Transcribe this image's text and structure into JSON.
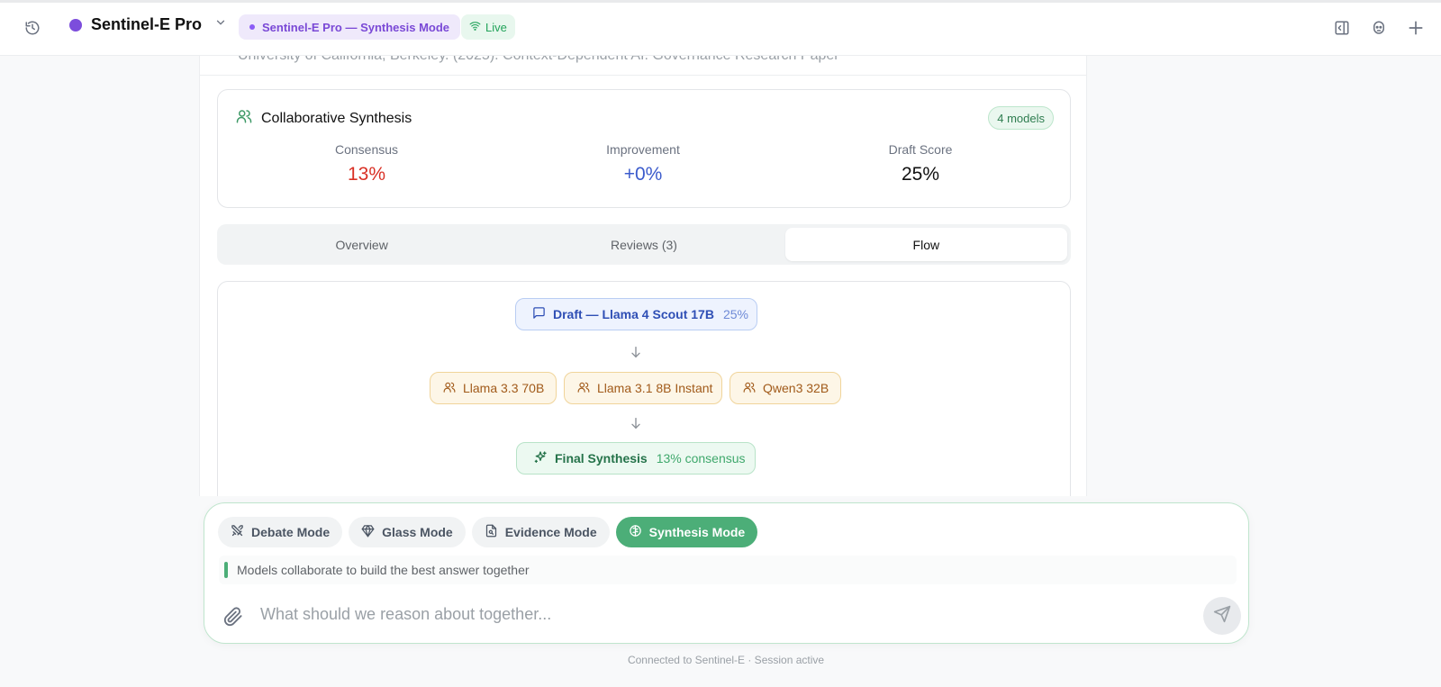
{
  "header": {
    "app_name": "Sentinel-E Pro",
    "mode_badge": "Sentinel-E Pro — Synthesis Mode",
    "live_badge": "Live",
    "colors": {
      "brand_dot": "#7c4ddc",
      "mode_badge": "#7a49d6",
      "live": "#22a35a"
    }
  },
  "content": {
    "cutoff_text": "University of California, Berkeley. (2025). Context-Dependent AI: Governance Research Paper",
    "synthesis": {
      "title": "Collaborative Synthesis",
      "models_badge": "4 models",
      "metrics": [
        {
          "label": "Consensus",
          "value": "13%"
        },
        {
          "label": "Improvement",
          "value": "+0%"
        },
        {
          "label": "Draft Score",
          "value": "25%"
        }
      ]
    },
    "tabs": [
      "Overview",
      "Reviews (3)",
      "Flow"
    ],
    "active_tab": "Flow",
    "flow": {
      "draft": {
        "label": "Draft — Llama 4 Scout 17B",
        "score": "25%"
      },
      "reviewers": [
        "Llama 3.3 70B",
        "Llama 3.1 8B Instant",
        "Qwen3 32B"
      ],
      "final": {
        "label": "Final Synthesis",
        "score": "13% consensus"
      }
    }
  },
  "composer": {
    "modes": [
      "Debate Mode",
      "Glass Mode",
      "Evidence Mode",
      "Synthesis Mode"
    ],
    "active_mode": "Synthesis Mode",
    "hint": "Models collaborate to build the best answer together",
    "placeholder": "What should we reason about together...",
    "accent_color": "#4cae78"
  },
  "footer": "Connected to Sentinel-E · Session active"
}
